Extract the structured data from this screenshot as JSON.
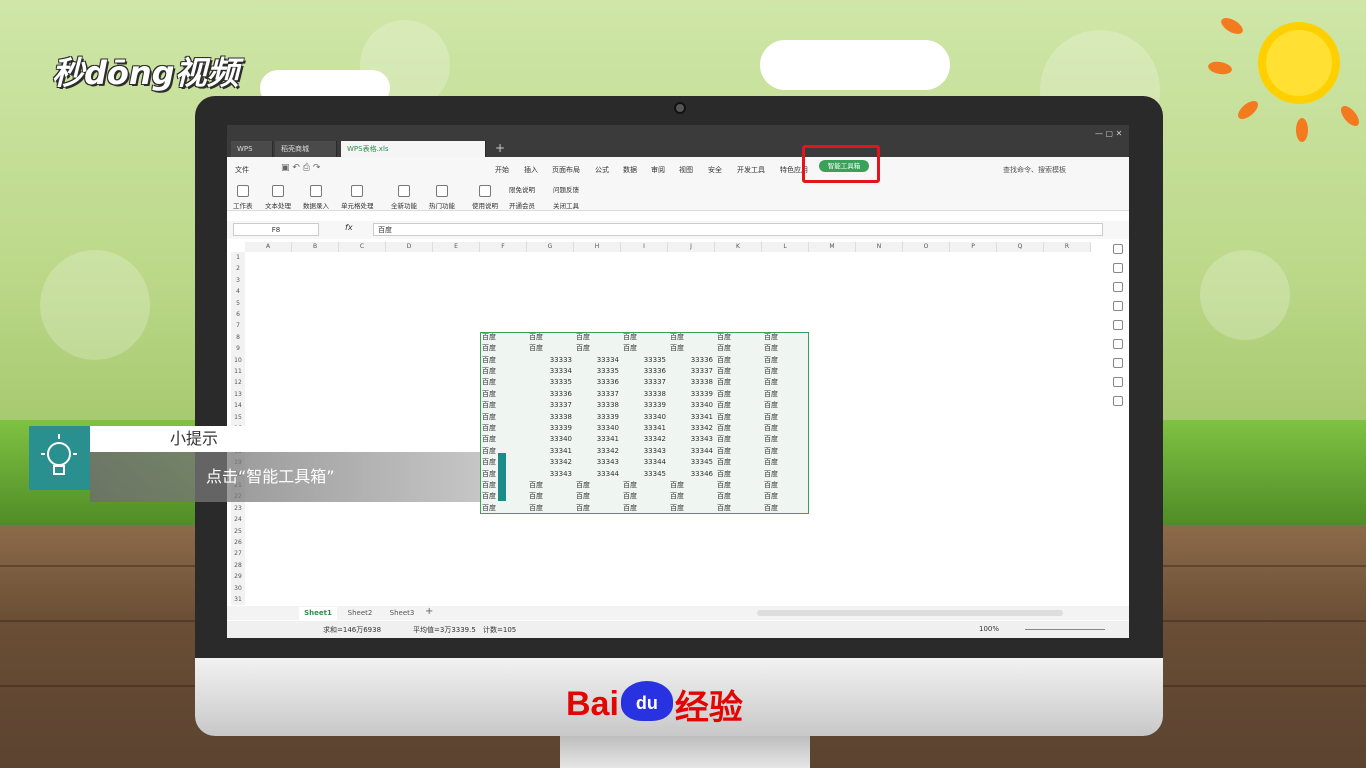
{
  "brand": {
    "video_logo": "秒dōng视频",
    "baidu_bai": "Bai",
    "baidu_du": "du",
    "baidu_jingyan": "经验"
  },
  "tabs": {
    "wps": "WPS",
    "store": "稻壳商城",
    "file": "WPS表格.xls"
  },
  "menu": [
    "文件",
    "开始",
    "插入",
    "页面布局",
    "公式",
    "数据",
    "审阅",
    "视图",
    "安全",
    "开发工具",
    "特色应用"
  ],
  "smart_toolbox": "智能工具箱",
  "search_placeholder": "查找命令、搜索模板",
  "tools": [
    "工作表",
    "文本处理",
    "数据录入",
    "单元格处理",
    "全新功能",
    "热门功能",
    "使用说明"
  ],
  "extra_tools": [
    "限免说明",
    "问题反馈",
    "开通会员",
    "关闭工具"
  ],
  "formula": {
    "cell": "F8",
    "fx": "fx",
    "value": "百度"
  },
  "columns": [
    "A",
    "B",
    "C",
    "D",
    "E",
    "F",
    "G",
    "H",
    "I",
    "J",
    "K",
    "L",
    "M",
    "N",
    "O",
    "P",
    "Q",
    "R"
  ],
  "rows": [
    "1",
    "2",
    "3",
    "4",
    "5",
    "6",
    "7",
    "8",
    "9",
    "10",
    "11",
    "12",
    "13",
    "14",
    "15",
    "16",
    "17",
    "18",
    "19",
    "20",
    "21",
    "22",
    "23",
    "24",
    "25",
    "26",
    "27",
    "28",
    "29",
    "30",
    "31"
  ],
  "cell_text": "百度",
  "num_rows": [
    [
      "33333",
      "33334",
      "33335",
      "33336"
    ],
    [
      "33334",
      "33335",
      "33336",
      "33337"
    ],
    [
      "33335",
      "33336",
      "33337",
      "33338"
    ],
    [
      "33336",
      "33337",
      "33338",
      "33339"
    ],
    [
      "33337",
      "33338",
      "33339",
      "33340"
    ],
    [
      "33338",
      "33339",
      "33340",
      "33341"
    ],
    [
      "33339",
      "33340",
      "33341",
      "33342"
    ],
    [
      "33340",
      "33341",
      "33342",
      "33343"
    ],
    [
      "33341",
      "33342",
      "33343",
      "33344"
    ],
    [
      "33342",
      "33343",
      "33344",
      "33345"
    ],
    [
      "33343",
      "33344",
      "33345",
      "33346"
    ]
  ],
  "sheets": [
    "Sheet1",
    "Sheet2",
    "Sheet3"
  ],
  "status": {
    "sum": "求和=146万6938",
    "avg": "平均值=3万3339.5",
    "count": "计数=105",
    "zoom": "100%"
  },
  "tip": {
    "title": "小提示",
    "body": "点击“智能工具箱”"
  },
  "colors": {
    "accent": "#3aa05a",
    "highlight": "#e3151c",
    "tip": "#2a8f8f"
  }
}
